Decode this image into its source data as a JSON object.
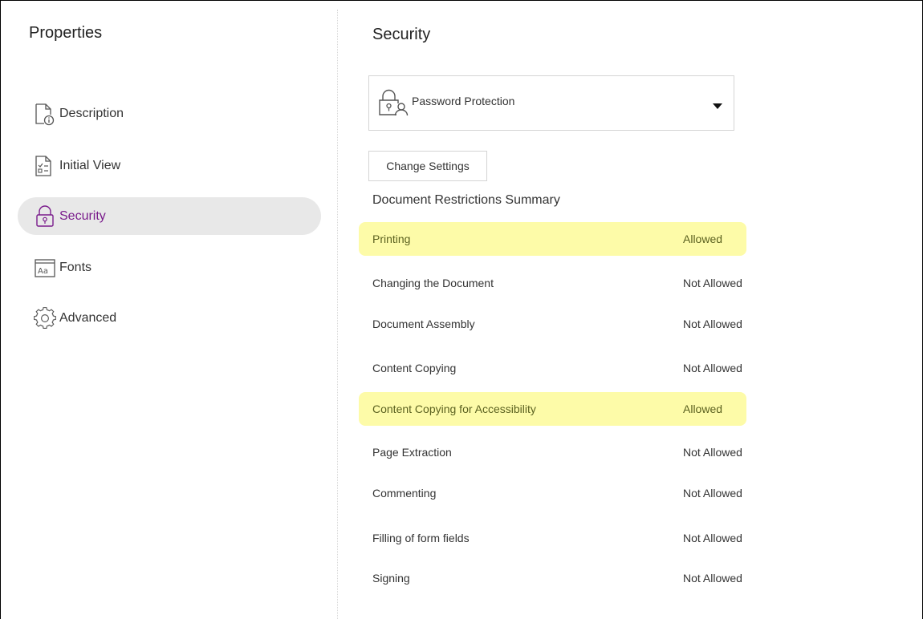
{
  "sidebar": {
    "title": "Properties",
    "items": [
      {
        "label": "Description",
        "icon": "document-info-icon"
      },
      {
        "label": "Initial View",
        "icon": "checklist-document-icon"
      },
      {
        "label": "Security",
        "icon": "lock-icon",
        "selected": true
      },
      {
        "label": "Fonts",
        "icon": "font-icon"
      },
      {
        "label": "Advanced",
        "icon": "gear-icon"
      }
    ]
  },
  "main": {
    "title": "Security",
    "dropdown": {
      "label": "Password Protection",
      "icon": "lock-user-icon"
    },
    "change_button": "Change Settings",
    "summary_title": "Document Restrictions Summary",
    "restrictions": [
      {
        "label": "Printing",
        "value": "Allowed",
        "highlight": true
      },
      {
        "label": "Changing the Document",
        "value": "Not Allowed",
        "highlight": false
      },
      {
        "label": "Document Assembly",
        "value": "Not Allowed",
        "highlight": false
      },
      {
        "label": "Content Copying",
        "value": "Not Allowed",
        "highlight": false
      },
      {
        "label": "Content Copying for Accessibility",
        "value": "Allowed",
        "highlight": true
      },
      {
        "label": "Page Extraction",
        "value": "Not Allowed",
        "highlight": false
      },
      {
        "label": "Commenting",
        "value": "Not Allowed",
        "highlight": false
      },
      {
        "label": "Filling of form fields",
        "value": "Not Allowed",
        "highlight": false
      },
      {
        "label": "Signing",
        "value": "Not Allowed",
        "highlight": false
      }
    ]
  },
  "colors": {
    "selected_text": "#7a1c8c",
    "selected_bg": "#e8e8e8",
    "highlight_bg": "#fdfba8"
  }
}
